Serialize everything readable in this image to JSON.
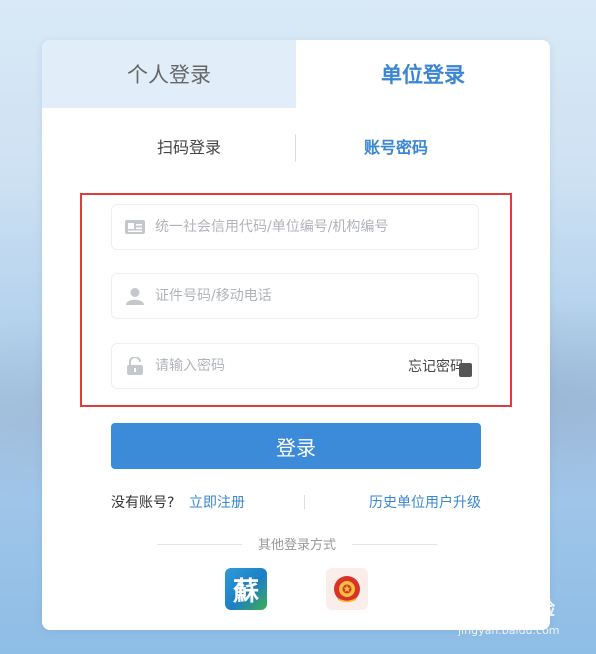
{
  "tabs": {
    "personal": "个人登录",
    "unit": "单位登录"
  },
  "subtabs": {
    "scan": "扫码登录",
    "account": "账号密码"
  },
  "fields": {
    "credit_code": {
      "placeholder": "统一社会信用代码/单位编号/机构编号",
      "value": "",
      "icon": "id-card-icon"
    },
    "id_number": {
      "placeholder": "证件号码/移动电话",
      "value": "",
      "icon": "user-icon"
    },
    "password": {
      "placeholder": "请输入密码",
      "value": "",
      "icon": "lock-icon"
    }
  },
  "forgot_password": "忘记密码",
  "login_button": "登录",
  "register": {
    "prompt": "没有账号?",
    "link": "立即注册"
  },
  "upgrade_link": "历史单位用户升级",
  "other_methods": {
    "label": "其他登录方式",
    "apps": [
      {
        "name": "su-app-icon",
        "glyph": "蘇"
      },
      {
        "name": "national-emblem-icon"
      }
    ]
  },
  "watermark": {
    "title": "Baidu 经验",
    "url": "jingyan.baidu.com"
  },
  "colors": {
    "accent": "#3b8bd8",
    "highlight_border": "#e33b3b",
    "personal_tab_bg": "#e1eefa"
  }
}
